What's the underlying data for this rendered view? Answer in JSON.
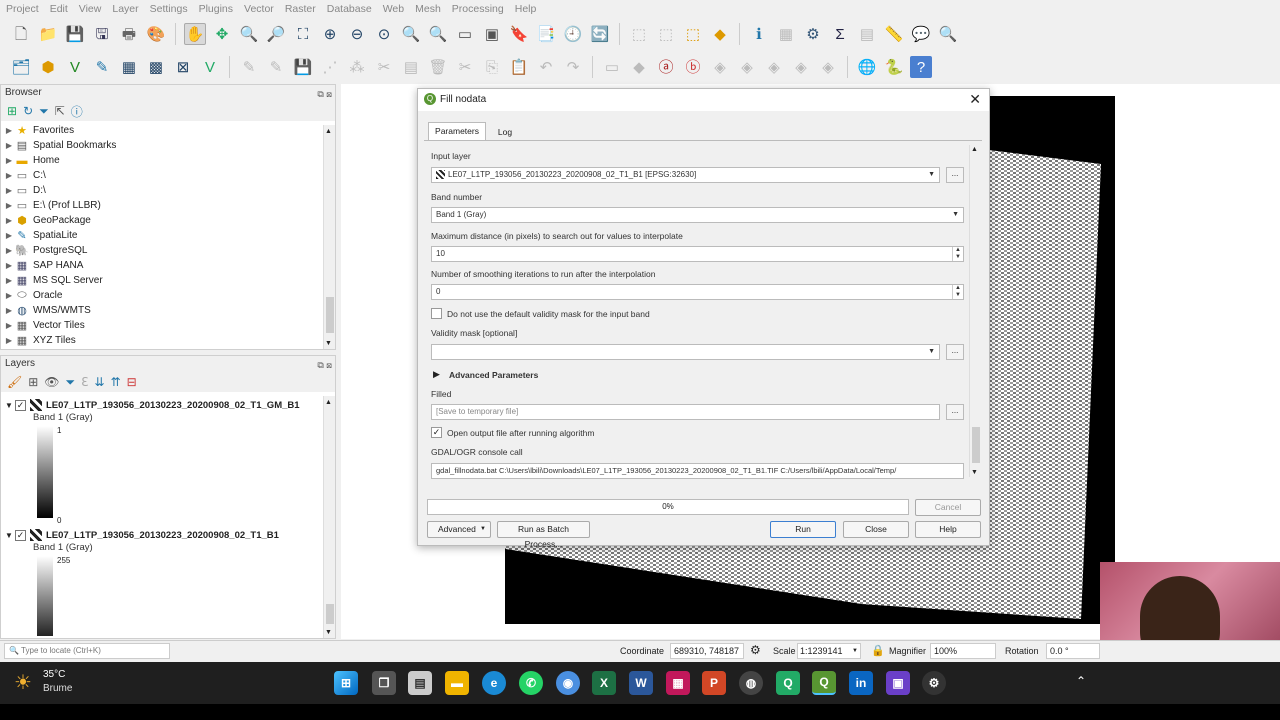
{
  "menu": [
    "Project",
    "Edit",
    "View",
    "Layer",
    "Settings",
    "Plugins",
    "Vector",
    "Raster",
    "Database",
    "Web",
    "Mesh",
    "Processing",
    "Help"
  ],
  "browser": {
    "title": "Browser",
    "items": [
      {
        "label": "Favorites",
        "icon": "star-icon"
      },
      {
        "label": "Spatial Bookmarks",
        "icon": "bookmark-icon"
      },
      {
        "label": "Home",
        "icon": "folder-icon"
      },
      {
        "label": "C:\\",
        "icon": "drive-icon"
      },
      {
        "label": "D:\\",
        "icon": "drive-icon"
      },
      {
        "label": "E:\\ (Prof LLBR)",
        "icon": "drive-icon"
      },
      {
        "label": "GeoPackage",
        "icon": "geopackage-icon"
      },
      {
        "label": "SpatiaLite",
        "icon": "spatialite-icon"
      },
      {
        "label": "PostgreSQL",
        "icon": "postgresql-icon"
      },
      {
        "label": "SAP HANA",
        "icon": "database-icon"
      },
      {
        "label": "MS SQL Server",
        "icon": "database-icon"
      },
      {
        "label": "Oracle",
        "icon": "oracle-icon"
      },
      {
        "label": "WMS/WMTS",
        "icon": "globe-icon"
      },
      {
        "label": "Vector Tiles",
        "icon": "grid-icon"
      },
      {
        "label": "XYZ Tiles",
        "icon": "grid-icon"
      }
    ]
  },
  "layers": {
    "title": "Layers",
    "items": [
      {
        "name": "LE07_L1TP_193056_20130223_20200908_02_T1_GM_B1",
        "band": "Band 1 (Gray)",
        "max": "1",
        "min": "0"
      },
      {
        "name": "LE07_L1TP_193056_20130223_20200908_02_T1_B1",
        "band": "Band 1 (Gray)",
        "max": "255",
        "min": ""
      }
    ]
  },
  "dialog": {
    "title": "Fill nodata",
    "tabs": [
      "Parameters",
      "Log"
    ],
    "input_layer_label": "Input layer",
    "input_layer_value": "LE07_L1TP_193056_20130223_20200908_02_T1_B1 [EPSG:32630]",
    "band_label": "Band number",
    "band_value": "Band 1 (Gray)",
    "maxdist_label": "Maximum distance (in pixels) to search out for values to interpolate",
    "maxdist_value": "10",
    "smooth_label": "Number of smoothing iterations to run after the interpolation",
    "smooth_value": "0",
    "nomask_label": "Do not use the default validity mask for the input band",
    "mask_label": "Validity mask [optional]",
    "advanced_params": "Advanced Parameters",
    "filled_label": "Filled",
    "filled_placeholder": "[Save to temporary file]",
    "open_output_label": "Open output file after running algorithm",
    "console_label": "GDAL/OGR console call",
    "console_value": "gdal_fillnodata.bat C:\\Users\\lbili\\Downloads\\LE07_L1TP_193056_20130223_20200908_02_T1_B1.TIF C:/Users/lbili/AppData/Local/Temp/",
    "progress_text": "0%",
    "progress": 0,
    "cancel": "Cancel",
    "advanced_btn": "Advanced",
    "batch_btn": "Run as Batch Process...",
    "run": "Run",
    "close": "Close",
    "help": "Help",
    "ellipsis": "..."
  },
  "status": {
    "locate_placeholder": "Type to locate (Ctrl+K)",
    "coordinate_label": "Coordinate",
    "coordinate_value": "689310, 748187",
    "scale_label": "Scale",
    "scale_value": "1:1239141",
    "magnifier_label": "Magnifier",
    "magnifier_value": "100%",
    "rotation_label": "Rotation",
    "rotation_value": "0.0 °"
  },
  "weather": {
    "temp": "35°C",
    "desc": "Brume"
  },
  "colors": {
    "accent": "#0078d7",
    "qgis_green": "#589632",
    "dialog_bg": "#f0f0f0"
  }
}
